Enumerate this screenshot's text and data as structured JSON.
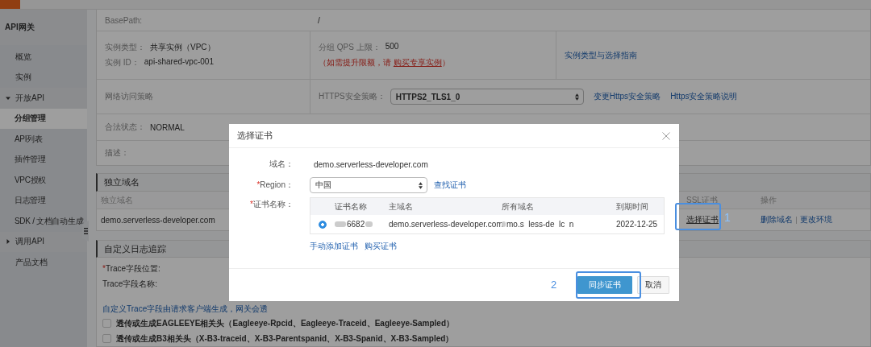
{
  "sidebar": {
    "title": "API网关",
    "items": [
      {
        "label": "概览",
        "kind": "link",
        "selected": false
      },
      {
        "label": "实例",
        "kind": "link",
        "selected": false
      },
      {
        "label": "开放API",
        "kind": "group",
        "selected": false,
        "expanded": true,
        "children": [
          {
            "label": "分组管理",
            "selected": true
          },
          {
            "label": "API列表",
            "selected": false
          },
          {
            "label": "插件管理",
            "selected": false
          },
          {
            "label": "VPC授权",
            "selected": false
          },
          {
            "label": "日志管理",
            "selected": false
          },
          {
            "label": "SDK / 文档自动生成",
            "selected": false
          }
        ]
      },
      {
        "label": "调用API",
        "kind": "group",
        "selected": false,
        "expanded": false
      },
      {
        "label": "产品文档",
        "kind": "link",
        "selected": false
      }
    ]
  },
  "info": {
    "base_path": {
      "label": "BasePath:",
      "value": "/"
    },
    "instance_type": {
      "label": "实例类型：",
      "value": "共享实例（VPC）"
    },
    "instance_id": {
      "label": "实例 ID：",
      "value": "api-shared-vpc-001"
    },
    "qps": {
      "label": "分组 QPS 上限：",
      "value": "500",
      "note_start": "（如需提升限额，请 ",
      "note_link": "购买专享实例",
      "note_end": "）"
    },
    "guide_link": "实例类型与选择指南",
    "network": {
      "label": "网络访问策略"
    },
    "https": {
      "label": "HTTPS安全策略：",
      "value": "HTTPS2_TLS1_0",
      "links": [
        "变更Https安全策略",
        "Https安全策略说明"
      ]
    },
    "status": {
      "label": "合法状态：",
      "value": "NORMAL"
    },
    "description": {
      "label": "描述："
    }
  },
  "domains": {
    "title": "独立域名",
    "columns": [
      "独立域名",
      "SSL证书",
      "操作"
    ],
    "rows": [
      {
        "domain": "demo.serverless-developer.com",
        "ssl_action": "选择证书",
        "actions": [
          "删除域名",
          "更改环境"
        ]
      }
    ]
  },
  "trace": {
    "title": "自定义日志追踪",
    "position_label": {
      "mark": "*",
      "text": "Trace字段位置:"
    },
    "name_label": "Trace字段名称:",
    "hint": "自定义Trace字段由请求客户端生成，网关会透",
    "options": [
      {
        "label": "透传或生成EAGLEEYE相关头（Eagleeye-Rpcid、Eagleeye-Traceid、Eagleeye-Sampled）",
        "checked": false
      },
      {
        "label": "透传或生成B3相关头（X-B3-traceid、X-B3-Parentspanid、X-B3-Spanid、X-B3-Sampled）",
        "checked": false
      }
    ]
  },
  "dialog": {
    "title": "选择证书",
    "domain_label": "域名：",
    "domain": "demo.serverless-developer.com",
    "region_label": {
      "mark": "*",
      "text": "Region："
    },
    "region": "中国",
    "find_link": "查找证书",
    "cert_label": {
      "mark": "*",
      "text": "证书名称："
    },
    "columns": [
      "证书名称",
      "主域名",
      "所有域名",
      "到期时间"
    ],
    "certs": [
      {
        "selected": true,
        "name": "6682",
        "main_domain": "demo.serverless-developer.com",
        "all_domains": "mo.s  less-de  lc  n",
        "expires": "2022-12-25"
      }
    ],
    "links": [
      "手动添加证书",
      "购买证书"
    ],
    "buttons": [
      {
        "label": "同步证书",
        "kind": "primary"
      },
      {
        "label": "取消",
        "kind": "default"
      }
    ]
  },
  "annotations": [
    {
      "label": "1"
    },
    {
      "label": "2"
    }
  ]
}
